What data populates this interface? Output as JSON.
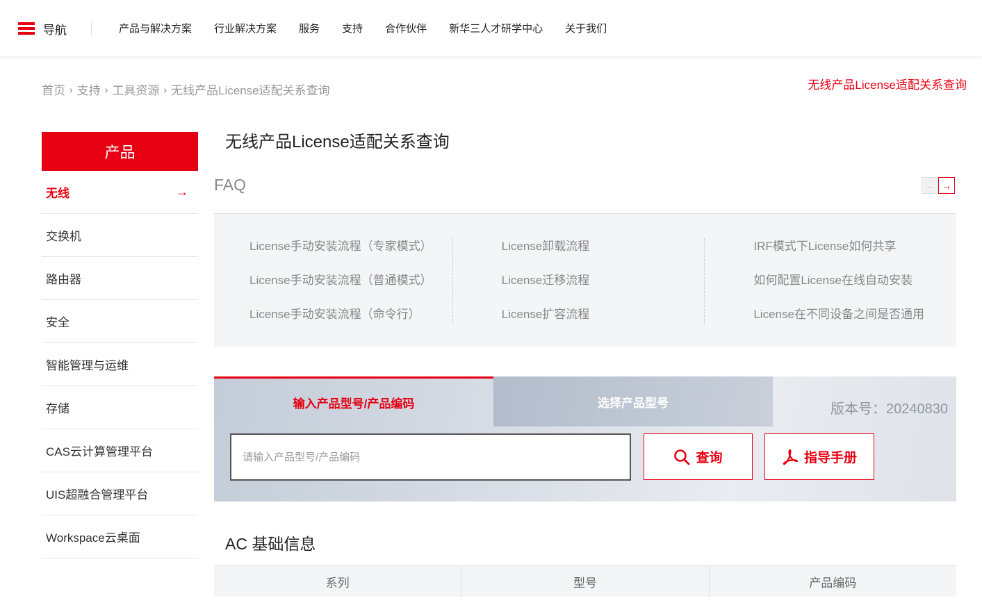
{
  "nav": {
    "menu_label": "导航",
    "items": [
      "产品与解决方案",
      "行业解决方案",
      "服务",
      "支持",
      "合作伙伴",
      "新华三人才研学中心",
      "关于我们"
    ]
  },
  "breadcrumb": {
    "items": [
      "首页",
      "支持",
      "工具资源",
      "无线产品License适配关系查询"
    ],
    "separator": "›"
  },
  "top_right_link": "无线产品License适配关系查询",
  "sidebar": {
    "heading": "产品",
    "items": [
      {
        "label": "无线",
        "active": true
      },
      {
        "label": "交换机"
      },
      {
        "label": "路由器"
      },
      {
        "label": "安全"
      },
      {
        "label": "智能管理与运维"
      },
      {
        "label": "存储"
      },
      {
        "label": "CAS云计算管理平台"
      },
      {
        "label": "UIS超融合管理平台"
      },
      {
        "label": "Workspace云桌面"
      }
    ]
  },
  "page_title": "无线产品License适配关系查询",
  "faq": {
    "title": "FAQ",
    "columns": [
      [
        "License手动安装流程（专家模式）",
        "License手动安装流程（普通模式）",
        "License手动安装流程（命令行）"
      ],
      [
        "License卸载流程",
        "License迁移流程",
        "License扩容流程"
      ],
      [
        "IRF模式下License如何共享",
        "如何配置License在线自动安装",
        "License在不同设备之间是否通用"
      ]
    ]
  },
  "query": {
    "tab_input": "输入产品型号/产品编码",
    "tab_select": "选择产品型号",
    "version": "版本号：20240830",
    "placeholder": "请输入产品型号/产品编码",
    "query_button": "查询",
    "manual_button": "指导手册"
  },
  "info": {
    "title": "AC 基础信息",
    "columns": [
      "系列",
      "型号",
      "产品编码"
    ]
  },
  "colors": {
    "accent": "#e60012"
  }
}
